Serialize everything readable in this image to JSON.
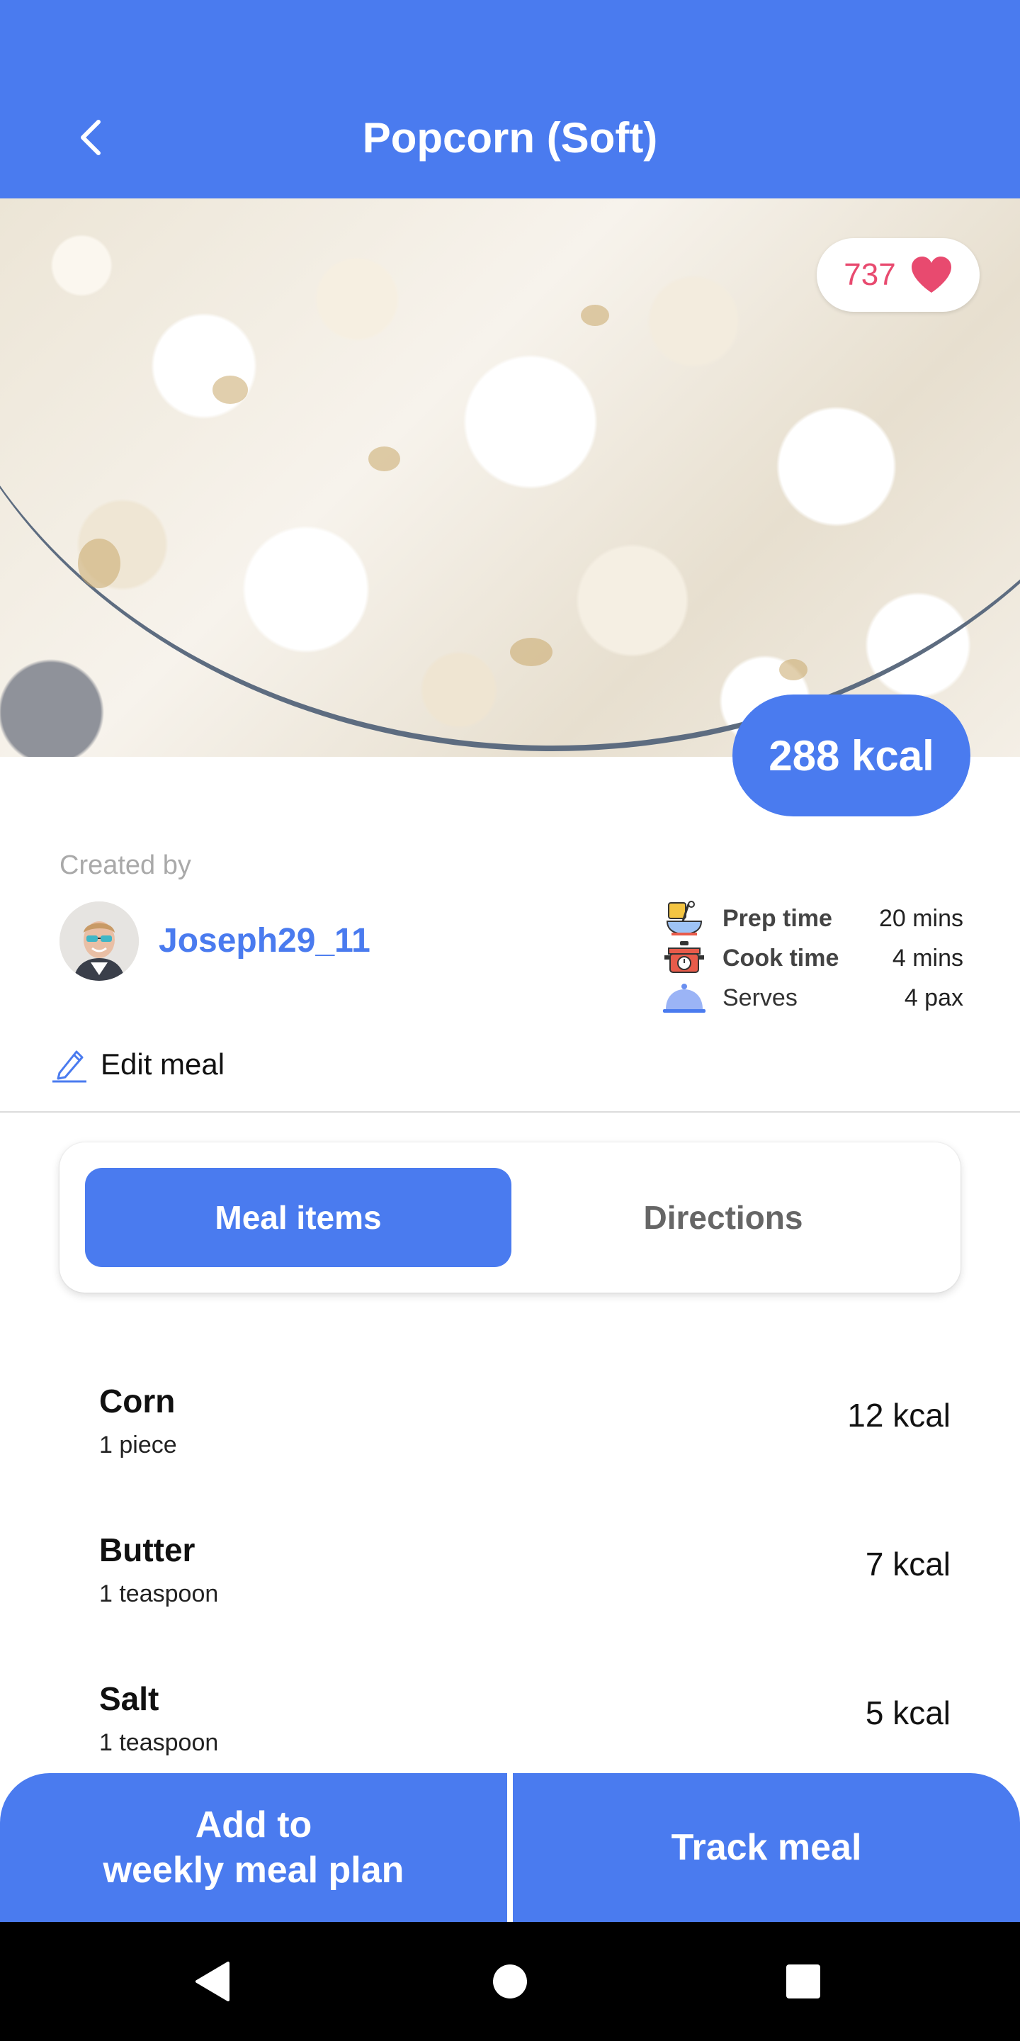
{
  "header": {
    "title": "Popcorn (Soft)",
    "back_icon": "chevron-left-icon"
  },
  "hero": {
    "likes": "737",
    "likes_icon": "heart-icon",
    "calories": "288 kcal"
  },
  "creator": {
    "label": "Created by",
    "username": "Joseph29_11",
    "avatar_icon": "avatar"
  },
  "meta": {
    "prep_label": "Prep time",
    "prep_value": "20 mins",
    "cook_label": "Cook time",
    "cook_value": "4 mins",
    "serves_label": "Serves",
    "serves_value": "4 pax"
  },
  "edit": {
    "label": "Edit meal",
    "icon": "pencil-icon"
  },
  "tabs": [
    {
      "label": "Meal items",
      "active": true
    },
    {
      "label": "Directions",
      "active": false
    }
  ],
  "items": [
    {
      "name": "Corn",
      "quantity": "1 piece",
      "kcal": "12 kcal"
    },
    {
      "name": "Butter",
      "quantity": "1 teaspoon",
      "kcal": "7 kcal"
    },
    {
      "name": "Salt",
      "quantity": "1 teaspoon",
      "kcal": "5 kcal"
    }
  ],
  "actions": {
    "plan_line1": "Add to",
    "plan_line2": "weekly meal plan",
    "track": "Track meal"
  },
  "colors": {
    "primary": "#4a7bef",
    "heart": "#e84a6f",
    "text_muted": "#a9a9a9"
  }
}
